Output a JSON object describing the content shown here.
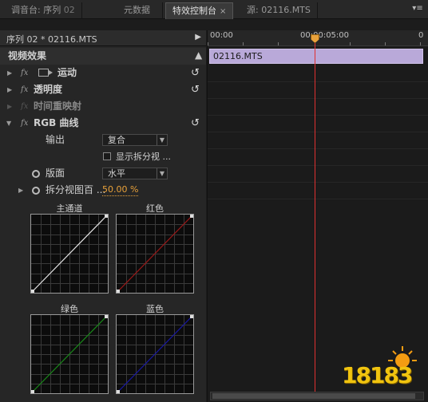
{
  "tabs": [
    {
      "label": "调音台: 序列",
      "suffix": "02"
    },
    {
      "label": "元数据"
    },
    {
      "label": "特效控制台",
      "close": "×"
    },
    {
      "label": "源: 02116.MTS"
    }
  ],
  "panel_menu_icon": "panel-menu-icon",
  "left_header": {
    "label": "序列 02 * 02116.MTS"
  },
  "section_title": "视频效果",
  "effects": [
    {
      "fx": "fx",
      "name": "运动"
    },
    {
      "fx": "fx",
      "name": "透明度"
    },
    {
      "fx": "fx",
      "name": "时间重映射"
    },
    {
      "fx": "fx",
      "name": "RGB 曲线"
    }
  ],
  "rgb_curves": {
    "output_label": "输出",
    "output_value": "复合",
    "split_view_label": "显示拆分视 ...",
    "layout_label": "版面",
    "layout_value": "水平",
    "split_pct_label": "拆分视图百 ...",
    "split_pct_value": "50.00 %",
    "curves": [
      {
        "title": "主通道",
        "color": "#e8e8e8"
      },
      {
        "title": "红色",
        "color": "#a01818"
      },
      {
        "title": "绿色",
        "color": "#1a8a1a"
      },
      {
        "title": "蓝色",
        "color": "#1818a8"
      }
    ]
  },
  "timeline": {
    "t0": "00:00",
    "t1": "00:00:05:00",
    "t2": "0",
    "clip": "02116.MTS"
  },
  "watermark": "18183"
}
